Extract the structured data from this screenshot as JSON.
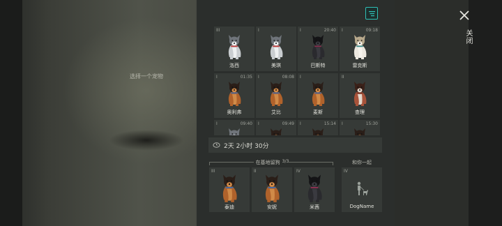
{
  "left": {
    "prompt": "选择一个宠物"
  },
  "header": {
    "filter_icon": "filter-icon",
    "close_icon": "close-x-icon",
    "close_label": "关闭"
  },
  "pets": [
    {
      "tier": "III",
      "timer": "",
      "name": "洛西",
      "coat": "husky"
    },
    {
      "tier": "I",
      "timer": "",
      "name": "美琪",
      "coat": "husky"
    },
    {
      "tier": "I",
      "timer": "20:40",
      "name": "巴斯特",
      "coat": "black"
    },
    {
      "tier": "I",
      "timer": "09:18",
      "name": "雷克斯",
      "coat": "white"
    },
    {
      "tier": "I",
      "timer": "01:35",
      "name": "奥利弗",
      "coat": "shepherd"
    },
    {
      "tier": "I",
      "timer": "08:08",
      "name": "艾比",
      "coat": "shepherd"
    },
    {
      "tier": "I",
      "timer": "",
      "name": "麦斯",
      "coat": "shepherd"
    },
    {
      "tier": "II",
      "timer": "",
      "name": "查理",
      "coat": "brown"
    },
    {
      "tier": "I",
      "timer": "09:40",
      "name": "",
      "coat": "husky"
    },
    {
      "tier": "I",
      "timer": "09:49",
      "name": "",
      "coat": "shepherd"
    },
    {
      "tier": "I",
      "timer": "15:14",
      "name": "",
      "coat": "shepherd"
    },
    {
      "tier": "I",
      "timer": "15:30",
      "name": "",
      "coat": "shepherd"
    }
  ],
  "duration": {
    "icon": "clock-icon",
    "text": "2天 2小时 30分"
  },
  "base": {
    "label": "在基地留狗",
    "count": "3/3"
  },
  "base_pets": [
    {
      "tier": "III",
      "name": "泰迪",
      "coat": "shepherd"
    },
    {
      "tier": "II",
      "name": "安妮",
      "coat": "shepherd"
    },
    {
      "tier": "IV",
      "name": "米茜",
      "coat": "black"
    }
  ],
  "with_you": {
    "label": "和你一起",
    "tier": "IV",
    "name": "DogName",
    "icon": "person-with-dog-icon"
  },
  "colors": {
    "accent": "#2fc0b7",
    "card_bg": "#363a37",
    "panel_bg": "#2b2e2c"
  }
}
